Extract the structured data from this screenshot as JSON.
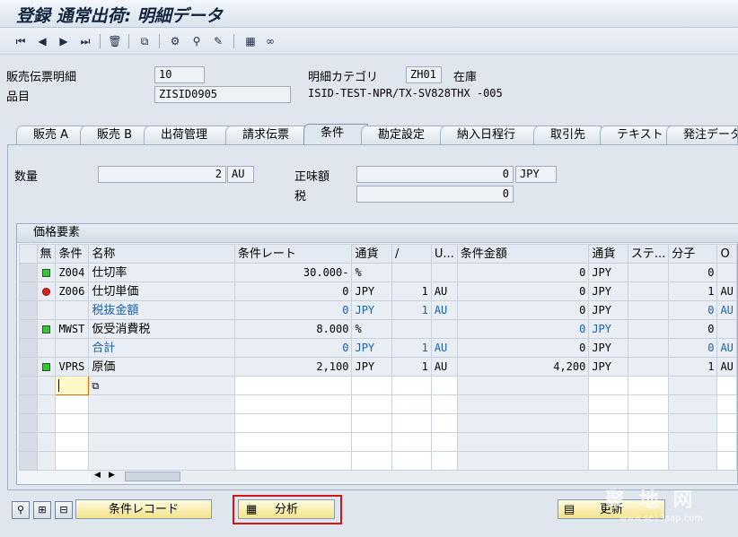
{
  "window": {
    "title": "登録 通常出荷: 明細データ"
  },
  "toolbar": {
    "icons": [
      "first-page-icon",
      "previous-page-icon",
      "next-page-icon",
      "last-page-icon",
      "delete-icon",
      "display-object-icon",
      "configure-icon",
      "find-icon",
      "edit-icon",
      "calculator-icon",
      "condition-icon"
    ]
  },
  "header": {
    "item_label": "販売伝票明細",
    "item_value": "10",
    "category_label": "明細カテゴリ",
    "category_value": "ZH01",
    "category_text": "在庫",
    "material_label": "品目",
    "material_value": "ZISID0905",
    "material_text": "ISID-TEST-NPR/TX-SV828THX -005"
  },
  "tabs": [
    {
      "label": "販売 A"
    },
    {
      "label": "販売 B"
    },
    {
      "label": "出荷管理"
    },
    {
      "label": "請求伝票"
    },
    {
      "label": "条件"
    },
    {
      "label": "勘定設定"
    },
    {
      "label": "納入日程行"
    },
    {
      "label": "取引先"
    },
    {
      "label": "テキスト"
    },
    {
      "label": "発注データ"
    }
  ],
  "active_tab": "条件",
  "conditions_header": {
    "qty_label": "数量",
    "qty_value": "2",
    "qty_unit": "AU",
    "net_label": "正味額",
    "net_value": "0",
    "net_currency": "JPY",
    "tax_label": "税",
    "tax_value": "0"
  },
  "grid": {
    "title": "価格要素",
    "columns": [
      "無",
      "条件",
      "名称",
      "条件レート",
      "通貨",
      "/",
      "U...",
      "条件金額",
      "通貨",
      "ステ...",
      "分子",
      "O"
    ],
    "rows": [
      {
        "status": "green",
        "cond": "Z004",
        "name": "仕切率",
        "rate": "30.000-",
        "cur": "%",
        "per": "",
        "uom": "",
        "amount": "0",
        "cur2": "JPY",
        "stat": "",
        "num": "0",
        "o": "",
        "subtotal": false
      },
      {
        "status": "red",
        "cond": "Z006",
        "name": "仕切単価",
        "rate": "0",
        "cur": "JPY",
        "per": "1",
        "uom": "AU",
        "amount": "0",
        "cur2": "JPY",
        "stat": "",
        "num": "1",
        "o": "AU",
        "subtotal": false
      },
      {
        "status": "",
        "cond": "",
        "name": "税抜金額",
        "rate": "0",
        "cur": "JPY",
        "per": "1",
        "uom": "AU",
        "amount": "0",
        "cur2": "JPY",
        "stat": "",
        "num": "0",
        "o": "AU",
        "subtotal": true
      },
      {
        "status": "green",
        "cond": "MWST",
        "name": "仮受消費税",
        "rate": "8.000",
        "cur": "%",
        "per": "",
        "uom": "",
        "amount": "0",
        "cur2": "JPY",
        "stat": "",
        "num": "0",
        "o": "",
        "subtotal": false,
        "amount_blue": true
      },
      {
        "status": "",
        "cond": "",
        "name": "合計",
        "rate": "0",
        "cur": "JPY",
        "per": "1",
        "uom": "AU",
        "amount": "0",
        "cur2": "JPY",
        "stat": "",
        "num": "0",
        "o": "AU",
        "subtotal": true
      },
      {
        "status": "green",
        "cond": "VPRS",
        "name": "原価",
        "rate": "2,100",
        "cur": "JPY",
        "per": "1",
        "uom": "AU",
        "amount": "4,200",
        "cur2": "JPY",
        "stat": "",
        "num": "1",
        "o": "AU",
        "subtotal": false
      }
    ]
  },
  "buttons": {
    "condition_record": "条件レコード",
    "analysis": "分析",
    "update": "更新"
  },
  "watermark": {
    "text": "聚 地 网",
    "url": "www.se13sap.com"
  },
  "colors": {
    "accent": "#d0141c",
    "subtotal_text": "#1a5fa8",
    "button_bg": "#f2e28c"
  }
}
